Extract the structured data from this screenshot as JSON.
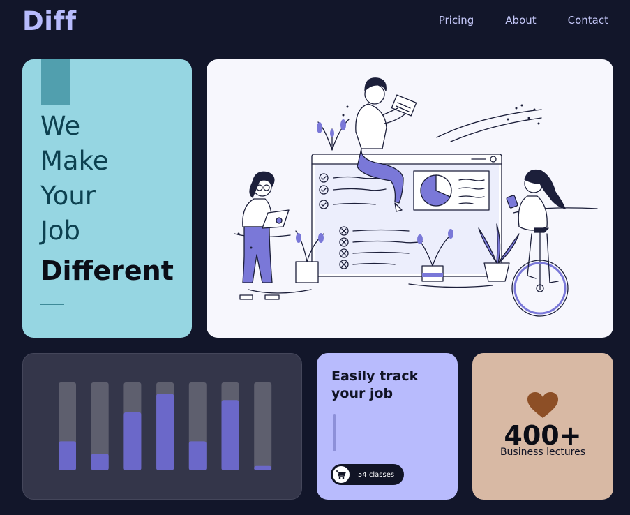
{
  "header": {
    "logo": "Diff",
    "nav": [
      {
        "label": "Pricing"
      },
      {
        "label": "About"
      },
      {
        "label": "Contact"
      }
    ]
  },
  "hero": {
    "lines": [
      "We",
      "Make",
      "Your",
      "Job"
    ],
    "emphasis": "Different"
  },
  "track_card": {
    "title_line1": "Easily track",
    "title_line2": "your job",
    "pill_label": "54 classes",
    "pill_icon": "cart-icon"
  },
  "stat_card": {
    "value": "400+",
    "caption": "Business lectures",
    "icon": "heart-icon"
  },
  "chart_data": {
    "type": "bar",
    "categories": [
      "",
      "",
      "",
      "",
      "",
      "",
      ""
    ],
    "values": [
      33,
      19,
      66,
      87,
      33,
      80,
      5
    ],
    "ylim": [
      0,
      100
    ],
    "title": "",
    "xlabel": "",
    "ylabel": "",
    "grid": false,
    "colors": {
      "track": "#5e5f6e",
      "fill": "#6b68c9"
    }
  },
  "colors": {
    "background": "#12162a",
    "accent": "#b7bbfc",
    "hero": "#96d6e2",
    "track": "#b8bbfd",
    "stat": "#d8b9a4",
    "heart": "#8d4f26"
  }
}
